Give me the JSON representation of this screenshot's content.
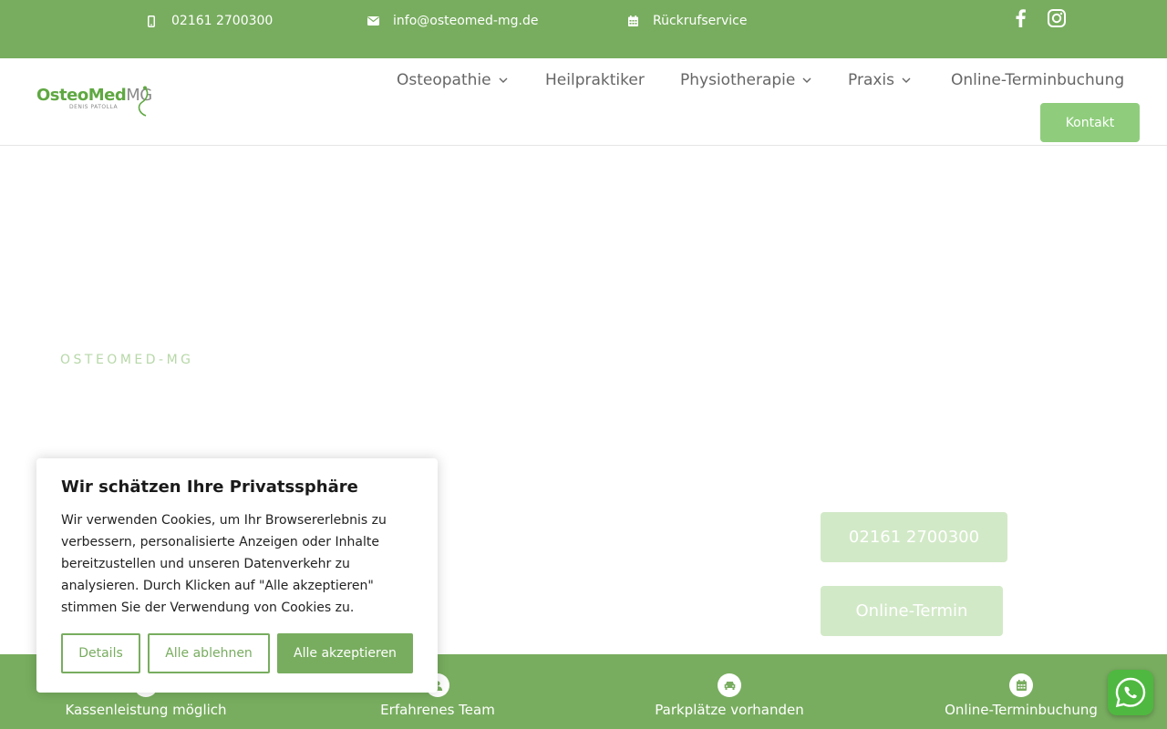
{
  "topbar": {
    "phone": "02161 2700300",
    "email": "info@osteomed-mg.de",
    "callback": "Rückrufservice",
    "social": [
      "facebook-icon",
      "instagram-icon"
    ]
  },
  "header": {
    "logo": {
      "brand_main": "OsteoMed",
      "brand_suffix": "MG",
      "subtitle": "DENIS PATOLLA"
    },
    "nav": [
      {
        "label": "Osteopathie",
        "has_dropdown": true
      },
      {
        "label": "Heilpraktiker",
        "has_dropdown": false
      },
      {
        "label": "Physiotherapie",
        "has_dropdown": true
      },
      {
        "label": "Praxis",
        "has_dropdown": true
      },
      {
        "label": "Online-Terminbuchung",
        "has_dropdown": false
      }
    ],
    "contact_button": "Kontakt"
  },
  "hero": {
    "tagline": "OSTEOMED-MG",
    "cta_phone": "02161 2700300",
    "cta_termin": "Online-Termin"
  },
  "features": [
    {
      "label": "Kassenleistung möglich",
      "icon": "check-icon"
    },
    {
      "label": "Erfahrenes Team",
      "icon": "team-icon"
    },
    {
      "label": "Parkplätze vorhanden",
      "icon": "car-icon"
    },
    {
      "label": "Online-Terminbuchung",
      "icon": "calendar-icon"
    }
  ],
  "cookie": {
    "title": "Wir schätzen Ihre Privatssphäre",
    "text": "Wir verwenden Cookies, um Ihr Browsererlebnis zu verbessern, personalisierte Anzeigen oder Inhalte bereitzustellen und unseren Datenverkehr zu analysieren. Durch Klicken auf \"Alle akzeptieren\" stimmen Sie der Verwendung von Cookies zu.",
    "details": "Details",
    "reject": "Alle ablehnen",
    "accept": "Alle akzeptieren"
  },
  "colors": {
    "brand_green": "#78ad5f",
    "button_green": "#8fcd7c",
    "light_green": "#d2e9c7",
    "whatsapp_green": "#4fb840"
  }
}
